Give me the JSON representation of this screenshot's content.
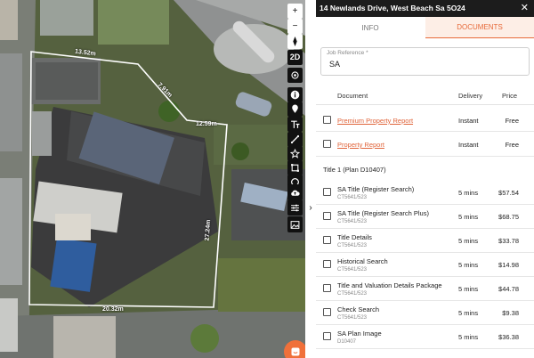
{
  "panel": {
    "address": "14 Newlands Drive, West Beach Sa 5O24",
    "close_icon": "close-icon",
    "tabs": {
      "info": "INFO",
      "documents": "DOCUMENTS",
      "active": "documents"
    },
    "job_reference": {
      "label": "Job Reference *",
      "value": "SA"
    },
    "columns": {
      "document": "Document",
      "delivery": "Delivery",
      "price": "Price"
    },
    "featured": [
      {
        "name": "Premium Property Report",
        "delivery": "Instant",
        "price": "Free"
      },
      {
        "name": "Property Report",
        "delivery": "Instant",
        "price": "Free"
      }
    ],
    "title_section": "Title 1 (Plan D10407)",
    "documents": [
      {
        "name": "SA Title (Register Search)",
        "ref": "CT5641/523",
        "delivery": "5 mins",
        "price": "$57.54"
      },
      {
        "name": "SA Title (Register Search Plus)",
        "ref": "CT5641/523",
        "delivery": "5 mins",
        "price": "$68.75"
      },
      {
        "name": "Title Details",
        "ref": "CT5641/523",
        "delivery": "5 mins",
        "price": "$33.78"
      },
      {
        "name": "Historical Search",
        "ref": "CT5641/523",
        "delivery": "5 mins",
        "price": "$14.98"
      },
      {
        "name": "Title and Valuation Details Package",
        "ref": "CT5641/523",
        "delivery": "5 mins",
        "price": "$44.78"
      },
      {
        "name": "Check Search",
        "ref": "CT5641/523",
        "delivery": "5 mins",
        "price": "$9.38"
      },
      {
        "name": "SA Plan Image",
        "ref": "D10407",
        "delivery": "5 mins",
        "price": "$36.38"
      }
    ]
  },
  "map": {
    "parcel_labels": [
      "13.52m",
      "7.91m",
      "12.59m",
      "27.24m",
      "20.32m"
    ],
    "tools": {
      "zoom_in": "+",
      "zoom_out": "−",
      "view_2d": "2D",
      "icons": [
        "zoom-in-icon",
        "zoom-out-icon",
        "compass-icon",
        "2d-toggle",
        "locate-icon",
        "info-icon",
        "pin-icon",
        "text-tool-icon",
        "measure-icon",
        "star-icon",
        "square-icon",
        "circle-icon",
        "cloud-upload-icon",
        "sliders-icon",
        "image-icon"
      ]
    },
    "collapse_icon": "chevron-right-icon",
    "chat_icon": "chat-icon"
  },
  "colors": {
    "accent": "#e76a3a",
    "topbar": "#1c1c1c",
    "tab_active_bg": "#fdeee6"
  }
}
